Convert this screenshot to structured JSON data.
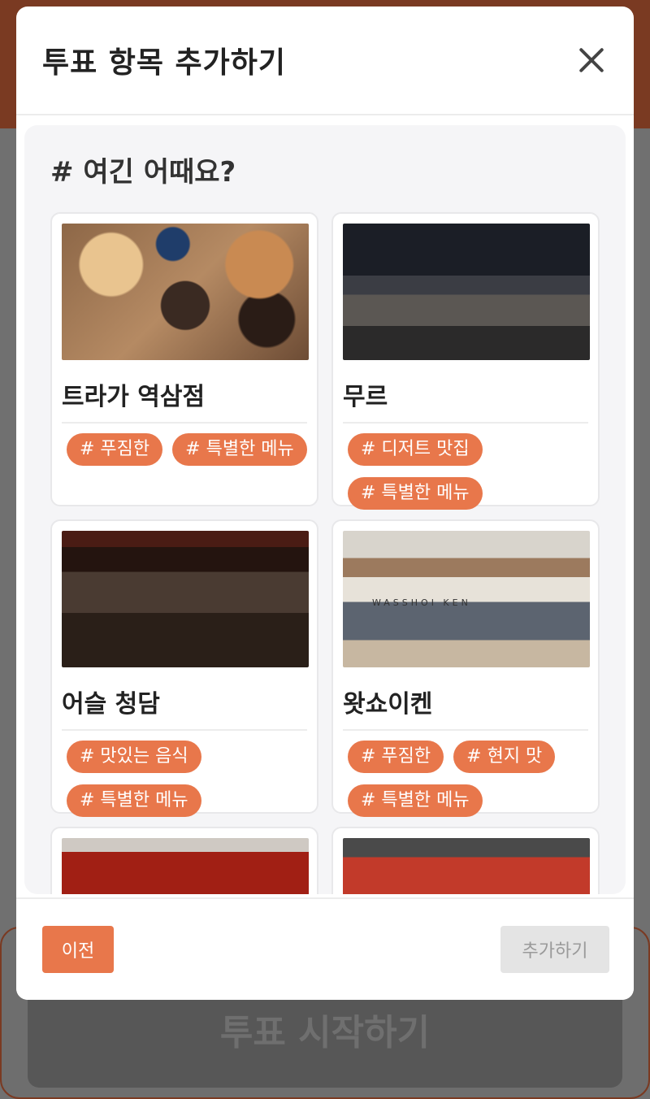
{
  "background": {
    "start_button_label": "투표 시작하기"
  },
  "modal": {
    "title": "투표 항목 추가하기",
    "section_title": "# 여긴 어때요?",
    "restaurants": [
      {
        "name": "트라가 역삼점",
        "image": "food-spread-photo",
        "tags": [
          "# 푸짐한",
          "# 특별한 메뉴"
        ]
      },
      {
        "name": "무르",
        "image": "bar-counter-photo",
        "tags": [
          "# 디저트 맛집",
          "# 특별한 메뉴"
        ]
      },
      {
        "name": "어슬 청담",
        "image": "dining-hall-photo",
        "tags": [
          "# 맛있는 음식",
          "# 특별한 메뉴"
        ]
      },
      {
        "name": "왓쇼이켄",
        "image": "open-kitchen-photo",
        "tags": [
          "# 푸짐한",
          "# 현지 맛",
          "# 특별한 메뉴"
        ],
        "sign": "WASSHOI KEN"
      },
      {
        "name": "",
        "image": "spicy-stew-photo",
        "tags": []
      },
      {
        "name": "",
        "image": "storefront-photo",
        "tags": []
      }
    ],
    "footer": {
      "prev_label": "이전",
      "add_label": "추가하기"
    }
  }
}
